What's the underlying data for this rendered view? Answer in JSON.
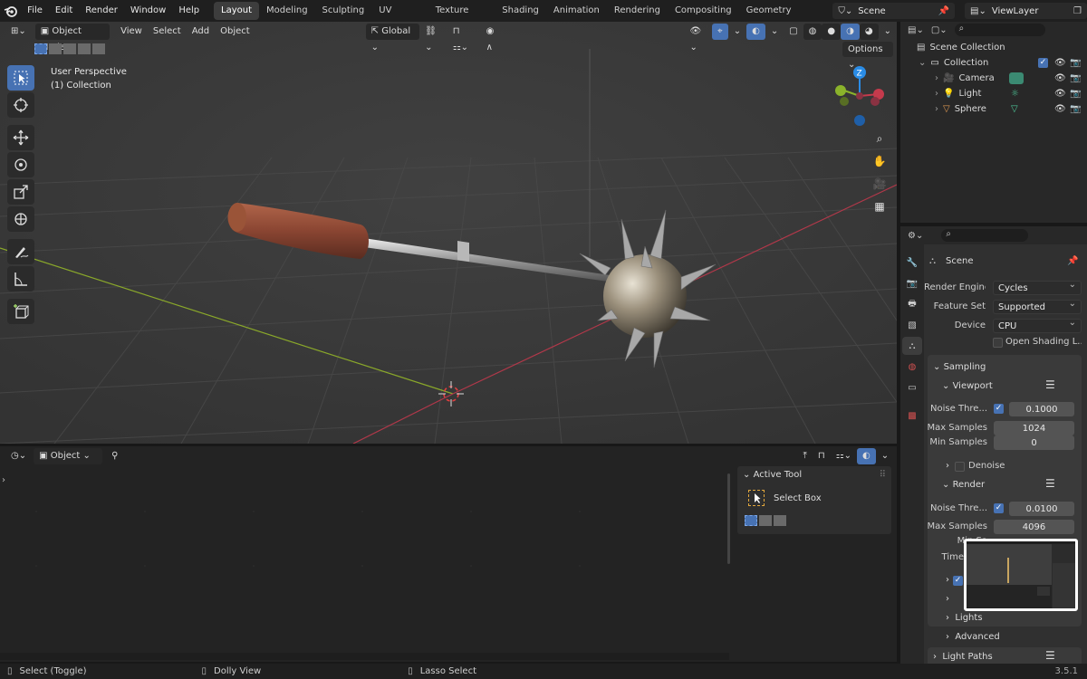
{
  "menu": [
    "File",
    "Edit",
    "Render",
    "Window",
    "Help"
  ],
  "workspaces": [
    "Layout",
    "Modeling",
    "Sculpting",
    "UV Editing",
    "Texture Paint",
    "Shading",
    "Animation",
    "Rendering",
    "Compositing",
    "Geometry Nodes"
  ],
  "active_workspace": "Layout",
  "scene_name": "Scene",
  "view_layer": "ViewLayer",
  "viewport": {
    "mode": "Object Mode",
    "menus": [
      "View",
      "Select",
      "Add",
      "Object"
    ],
    "orientation": "Global",
    "options_label": "Options",
    "overlay_line1": "User Perspective",
    "overlay_line2": "(1) Collection",
    "gizmo_axis": "Z"
  },
  "outliner": {
    "root": "Scene Collection",
    "collection": "Collection",
    "items": [
      "Camera",
      "Light",
      "Sphere"
    ]
  },
  "properties": {
    "context": "Scene",
    "render_engine_label": "Render Engine",
    "render_engine": "Cycles",
    "feature_set_label": "Feature Set",
    "feature_set": "Supported",
    "device_label": "Device",
    "device": "CPU",
    "open_shading": "Open Shading L...",
    "sampling": "Sampling",
    "viewport_panel": "Viewport",
    "noise_label": "Noise Thre...",
    "viewport_noise": "0.1000",
    "max_samples_label": "Max Samples",
    "viewport_max": "1024",
    "min_samples_label": "Min Samples",
    "viewport_min": "0",
    "denoise": "Denoise",
    "render_panel": "Render",
    "render_noise": "0.0100",
    "render_max": "4096",
    "min_sa": "Min Sa",
    "time": "Time",
    "lights": "Lights",
    "advanced": "Advanced",
    "light_paths": "Light Paths"
  },
  "timeline": {
    "mode": "Object"
  },
  "active_tool": {
    "header": "Active Tool",
    "tool": "Select Box"
  },
  "status": {
    "select": "Select (Toggle)",
    "dolly": "Dolly View",
    "lasso": "Lasso Select",
    "version": "3.5.1"
  },
  "colors": {
    "accent": "#4772b3",
    "x_axis": "#c53a4c",
    "y_axis": "#8bb32b",
    "z_axis": "#2a8ce6"
  }
}
